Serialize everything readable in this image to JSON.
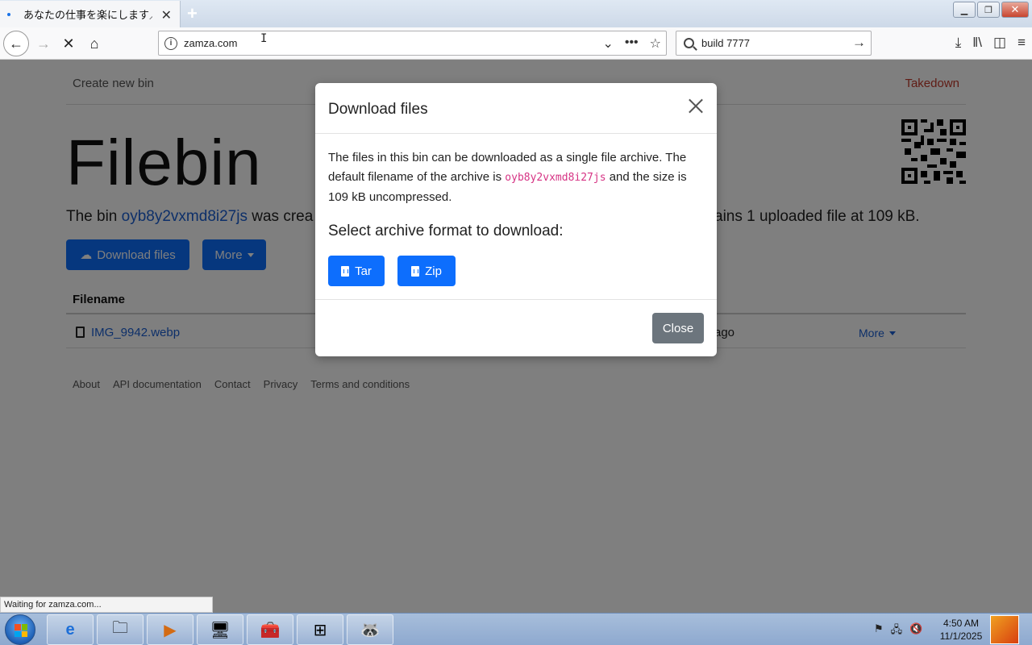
{
  "browser": {
    "tab_title": "あなたの仕事を楽にします／S",
    "url": "zamza.com",
    "search_value": "build 7777",
    "status_text": "Waiting for zamza.com..."
  },
  "page": {
    "create_link": "Create new bin",
    "takedown_link": "Takedown",
    "title": "Filebin",
    "bin_prefix": "The bin ",
    "bin_id": "oyb8y2vxmd8i27js",
    "bin_mid": " was crea",
    "bin_suffix": "ains 1 uploaded file at 109 kB.",
    "download_button": "Download files",
    "more_button": "More",
    "table_header_filename": "Filename",
    "file_name": "IMG_9942.webp",
    "file_ago": "ago",
    "row_more": "More",
    "footer_links": [
      "About",
      "API documentation",
      "Contact",
      "Privacy",
      "Terms and conditions"
    ]
  },
  "modal": {
    "title": "Download files",
    "body_part1": "The files in this bin can be downloaded as a single file archive. The default filename of the archive is ",
    "archive_name": "oyb8y2vxmd8i27js",
    "body_part2": " and the size is 109 kB uncompressed.",
    "subtitle": "Select archive format to download:",
    "tar_label": "Tar",
    "zip_label": "Zip",
    "close_label": "Close"
  },
  "taskbar": {
    "time": "4:50 AM",
    "date": "11/1/2025"
  },
  "colors": {
    "primary": "#0d6efd",
    "secondary": "#6c757d",
    "link": "#1a5fd3",
    "code": "#d63384"
  }
}
